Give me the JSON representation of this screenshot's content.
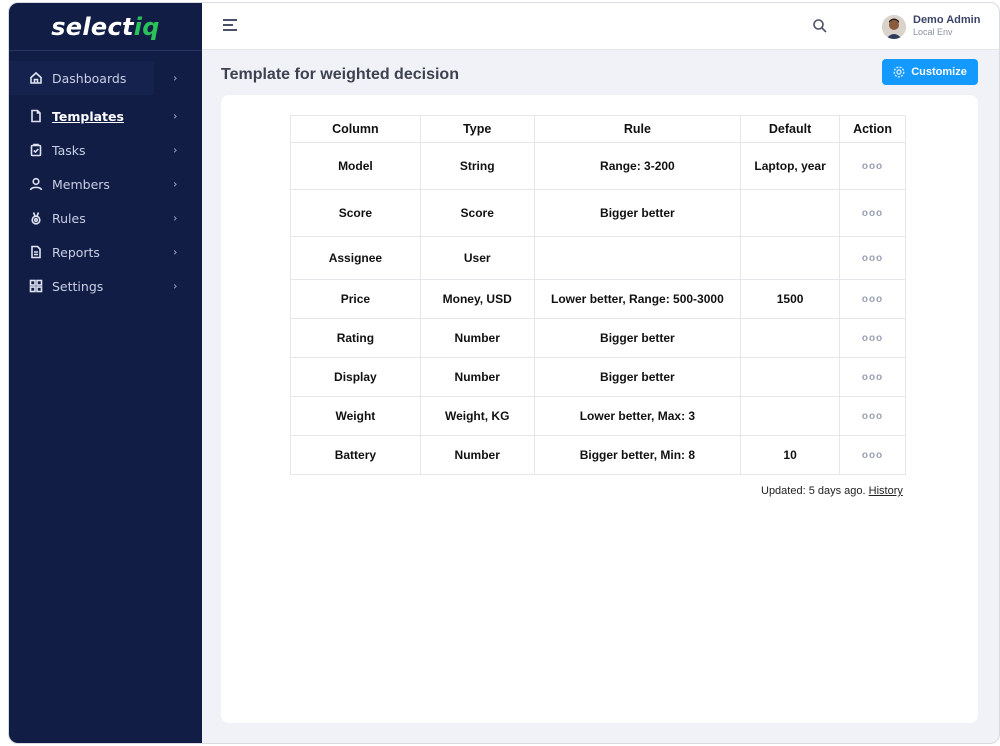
{
  "app": {
    "logo_main": "select",
    "logo_accent": "iq"
  },
  "sidebar": {
    "items": [
      {
        "label": "Dashboards",
        "icon": "home-icon"
      },
      {
        "label": "Templates",
        "icon": "file-icon",
        "active": true
      },
      {
        "label": "Tasks",
        "icon": "clipboard-icon"
      },
      {
        "label": "Members",
        "icon": "user-icon"
      },
      {
        "label": "Rules",
        "icon": "medal-icon"
      },
      {
        "label": "Reports",
        "icon": "report-icon"
      },
      {
        "label": "Settings",
        "icon": "grid-icon"
      }
    ]
  },
  "topbar": {
    "user_name": "Demo Admin",
    "user_env": "Local Env"
  },
  "page": {
    "title": "Template for weighted decision",
    "customize_label": "Customize"
  },
  "table": {
    "headers": [
      "Column",
      "Type",
      "Rule",
      "Default",
      "Action"
    ],
    "rows": [
      [
        "Model",
        "String",
        "Range: 3-200",
        "Laptop, year",
        "ooo"
      ],
      [
        "Score",
        "Score",
        "Bigger better",
        "",
        "ooo"
      ],
      [
        "Assignee",
        "User",
        "",
        "",
        "ooo"
      ],
      [
        "Price",
        "Money, USD",
        "Lower better, Range: 500-3000",
        "1500",
        "ooo"
      ],
      [
        "Rating",
        "Number",
        "Bigger better",
        "",
        "ooo"
      ],
      [
        "Display",
        "Number",
        "Bigger better",
        "",
        "ooo"
      ],
      [
        "Weight",
        "Weight, KG",
        "Lower better,  Max: 3",
        "",
        "ooo"
      ],
      [
        "Battery",
        "Number",
        "Bigger better, Min: 8",
        "10",
        "ooo"
      ]
    ]
  },
  "footer": {
    "updated_text": "Updated: 5 days ago.",
    "history_link": "History"
  },
  "colors": {
    "sidebar_bg": "#121d45",
    "accent": "#1499ff",
    "logo_accent": "#2bc25b"
  }
}
